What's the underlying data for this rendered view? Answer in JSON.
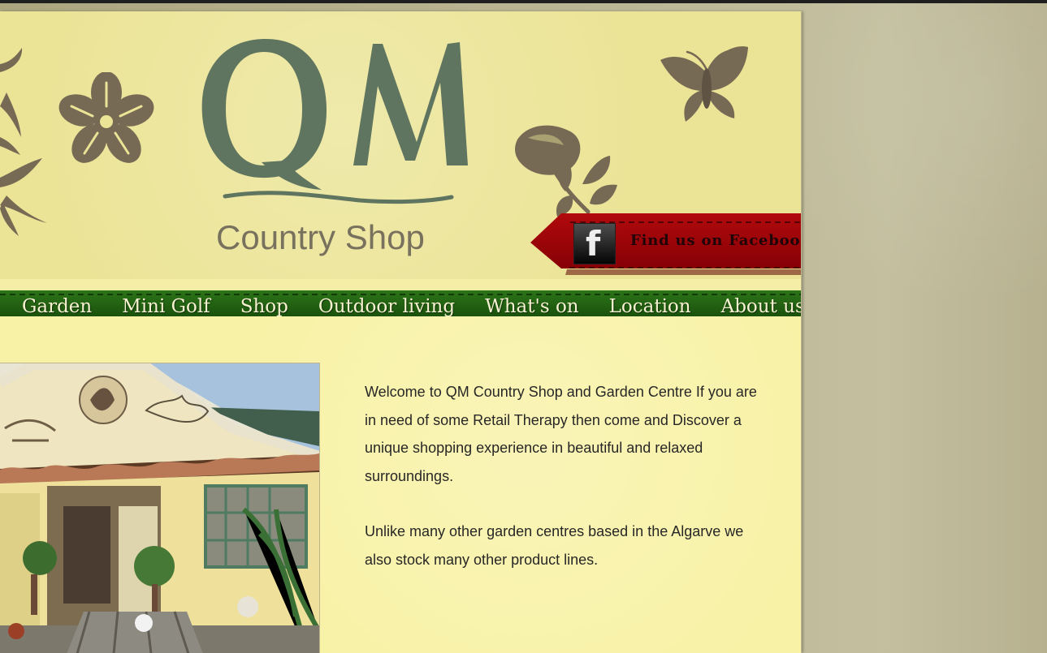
{
  "brand": {
    "logo_text": "QM",
    "subtitle": "Country Shop"
  },
  "facebook": {
    "label": "Find us on Facebook!",
    "icon": "facebook-icon"
  },
  "navigation": {
    "items": [
      {
        "label": "Garden"
      },
      {
        "label": "Mini Golf"
      },
      {
        "label": "Shop"
      },
      {
        "label": "Outdoor living"
      },
      {
        "label": "What's on"
      },
      {
        "label": "Location"
      },
      {
        "label": "About us"
      }
    ]
  },
  "main": {
    "paragraphs": [
      "Welcome to QM Country Shop and Garden Centre If you are in need of some Retail Therapy then come and Discover a unique shopping experience in beautiful and relaxed surroundings.",
      "Unlike many other garden centres based in the Algarve we also stock many other product lines."
    ]
  },
  "icons": {
    "flower": "flower-icon",
    "butterfly": "butterfly-icon",
    "rose": "rose-icon",
    "leaf": "leaf-icon",
    "facebook": "facebook-icon"
  },
  "colors": {
    "background": "#b9b48f",
    "page": "#f4eea6",
    "logo_green": "#5f7560",
    "decoration_brown": "#766a55",
    "facebook_red": "#8d0106",
    "nav_green": "#1f5a0f",
    "text": "#282727"
  }
}
